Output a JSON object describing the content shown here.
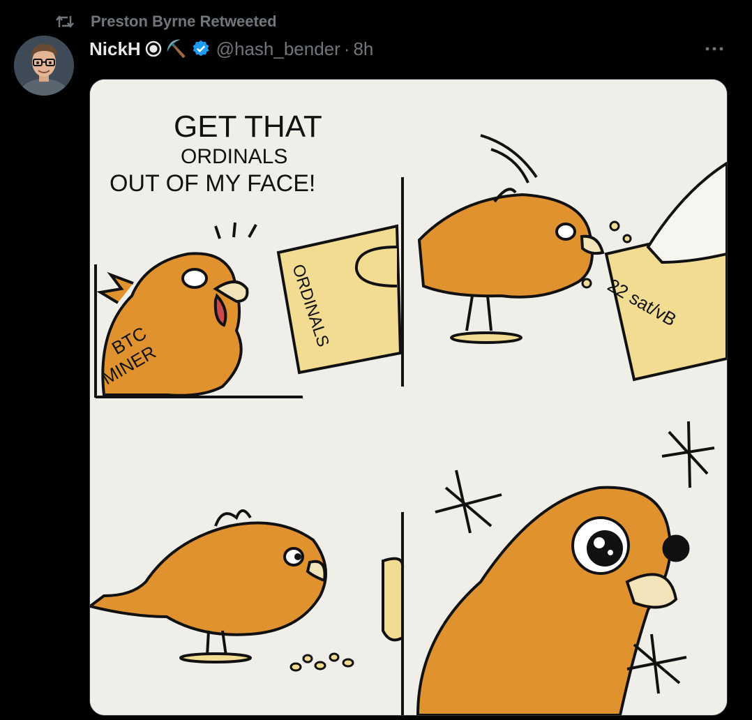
{
  "tweet": {
    "retweeted_by": "Preston Byrne Retweeted",
    "author_name": "NickH",
    "author_emoji": "⛏️",
    "author_handle": "@hash_bender",
    "separator": "·",
    "time": "8h"
  },
  "comic": {
    "speech": [
      "GET THAT",
      "ORDINALS",
      "OUT OF MY FACE!"
    ],
    "bird_label": [
      "BTC",
      "MINER"
    ],
    "card_label": "ORDINALS",
    "fee_label": "22 sat/vB"
  },
  "icons": {
    "retweet": "retweet-icon",
    "status": "circle-badge-icon",
    "verified": "verified-check-icon",
    "more": "more-icon"
  },
  "colors": {
    "background": "#000000",
    "primary_text": "#e7e9ea",
    "secondary_text": "#71767b",
    "verified": "#1d9bf0",
    "bird": "#e0922e",
    "card": "#f2dc91",
    "panel": "#efeee9"
  }
}
